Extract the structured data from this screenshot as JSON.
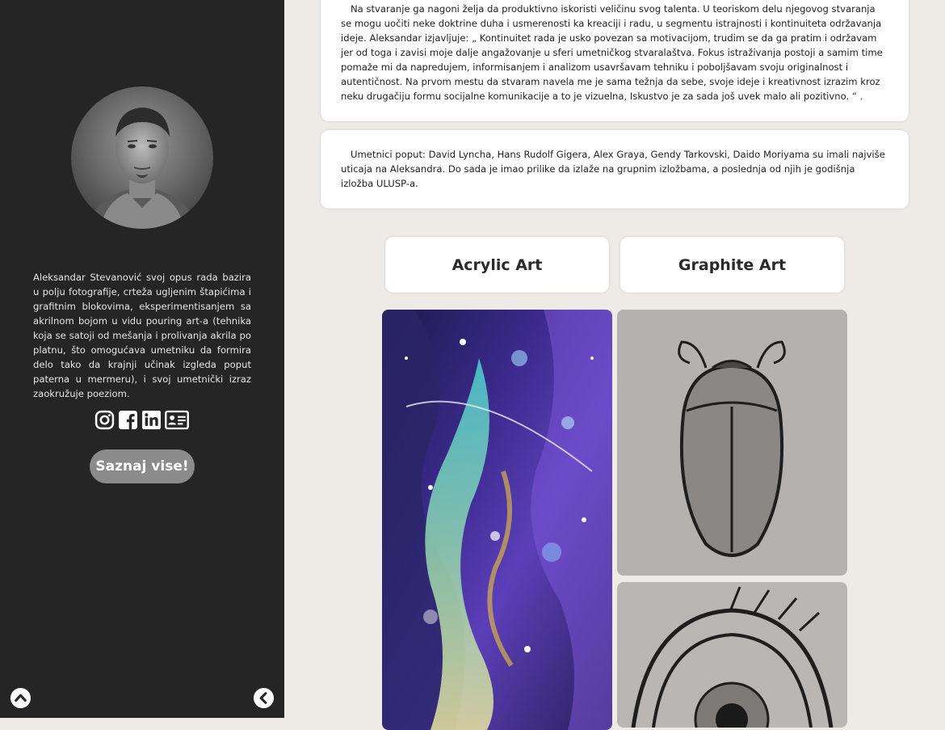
{
  "sidebar": {
    "bio": "Aleksandar Stevanović svoj opus rada bazira u polju fotografije, crteža ugljenim štapićima i grafitnim blokovima, eksperimentisanjem sa akrilnom bojom u vidu pouring art-a (tehnika koja se satoji od mešanja i prolivanja akrila po platnu, što omogućava umetniku da formira delo tako da krajnji učinak izgleda poput paterna u mermeru), i svoj umetnički izraz zaokružuje poeziom.",
    "social_icons": [
      "instagram-icon",
      "facebook-icon",
      "linkedin-icon",
      "contact-card-icon"
    ],
    "more_button": "Saznaj vise!"
  },
  "main": {
    "paragraph1": "Na stvaranje ga nagoni želja da produktivno iskoristi veličinu svog talenta. U teoriskom delu njegovog stvaranja se mogu uočiti neke doktrine duha i usmerenosti ka kreaciji i radu, u segmentu istrajnosti i kontinuiteta održavanja ideje. Aleksandar izjavljuje: „ Kontinuitet rada je usko povezan sa motivacijom, trudim se da ga pratim i održavam jer od toga i zavisi moje dalje angažovanje u sferi umetničkog stvaralaštva. Fokus istraživanja postoji a samim time pomaže mi da napredujem, informisanjem i analizom usavršavam tehniku i poboljšavam svoju originalnost i autentičnost. Na prvom mestu da stvaram navela me je sama težnja da sebe, svoje ideje i kreativnost izrazim kroz neku drugačiju formu socijalne komunikacije a to je vizuelna, Iskustvo je za sada još uvek malo ali pozitivno. “ .",
    "paragraph2": "Umetnici poput: David Lyncha, Hans Rudolf Gigera, Alex Graya, Gendy Tarkovski, Daido Moriyama su imali najviše uticaja na Aleksandra. Do sada je imao prilike da izlaže na grupnim izložbama, a poslednja od njih je godišnja izložba ULUSP-a.",
    "tabs": [
      {
        "label": "Acrylic Art"
      },
      {
        "label": "Graphite Art"
      }
    ]
  },
  "colors": {
    "sidebar_bg": "#252525",
    "page_bg": "#eeeae6",
    "button_bg": "#8b8b8b"
  }
}
